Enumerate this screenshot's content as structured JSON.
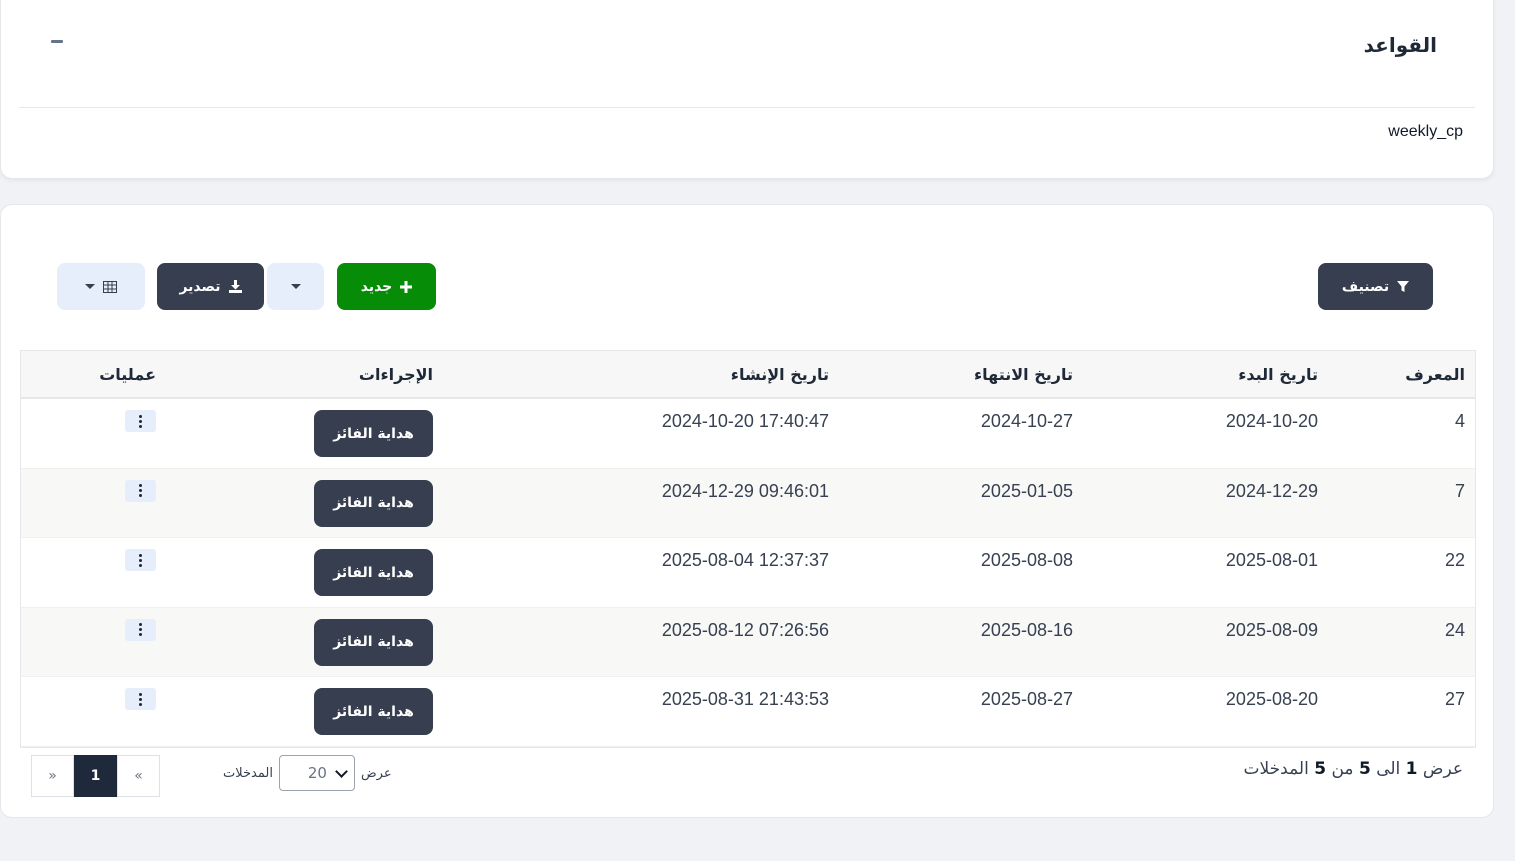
{
  "rules_card": {
    "title": "القواعد",
    "rule_text": "weekly_cp"
  },
  "toolbar": {
    "filter_label": "تصنيف",
    "new_label": "جديد",
    "export_label": "تصدير"
  },
  "table": {
    "headers": {
      "id": "المعرف",
      "start": "تاريخ البدء",
      "end": "تاريخ الانتهاء",
      "created": "تاريخ الإنشاء",
      "actions": "الإجراءات",
      "ops": "عمليات"
    },
    "action_button_label": "هداية الفائز",
    "rows": [
      {
        "id": "4",
        "start": "2024-10-20",
        "end": "2024-10-27",
        "created": "2024-10-20 17:40:47"
      },
      {
        "id": "7",
        "start": "2024-12-29",
        "end": "2025-01-05",
        "created": "2024-12-29 09:46:01"
      },
      {
        "id": "22",
        "start": "2025-08-01",
        "end": "2025-08-08",
        "created": "2025-08-04 12:37:37"
      },
      {
        "id": "24",
        "start": "2025-08-09",
        "end": "2025-08-16",
        "created": "2025-08-12 07:26:56"
      },
      {
        "id": "27",
        "start": "2025-08-20",
        "end": "2025-08-27",
        "created": "2025-08-31 21:43:53"
      }
    ]
  },
  "footer": {
    "summary_show": "عرض",
    "summary_from": "1",
    "summary_to_word": "الى",
    "summary_to": "5",
    "summary_of_word": "من",
    "summary_total": "5",
    "summary_entries": "المدخلات",
    "per_page_show": "عرض",
    "per_page_value": "20",
    "per_page_entries": "المدخلات",
    "pager": {
      "prev": "«",
      "current": "1",
      "next": "»"
    }
  }
}
